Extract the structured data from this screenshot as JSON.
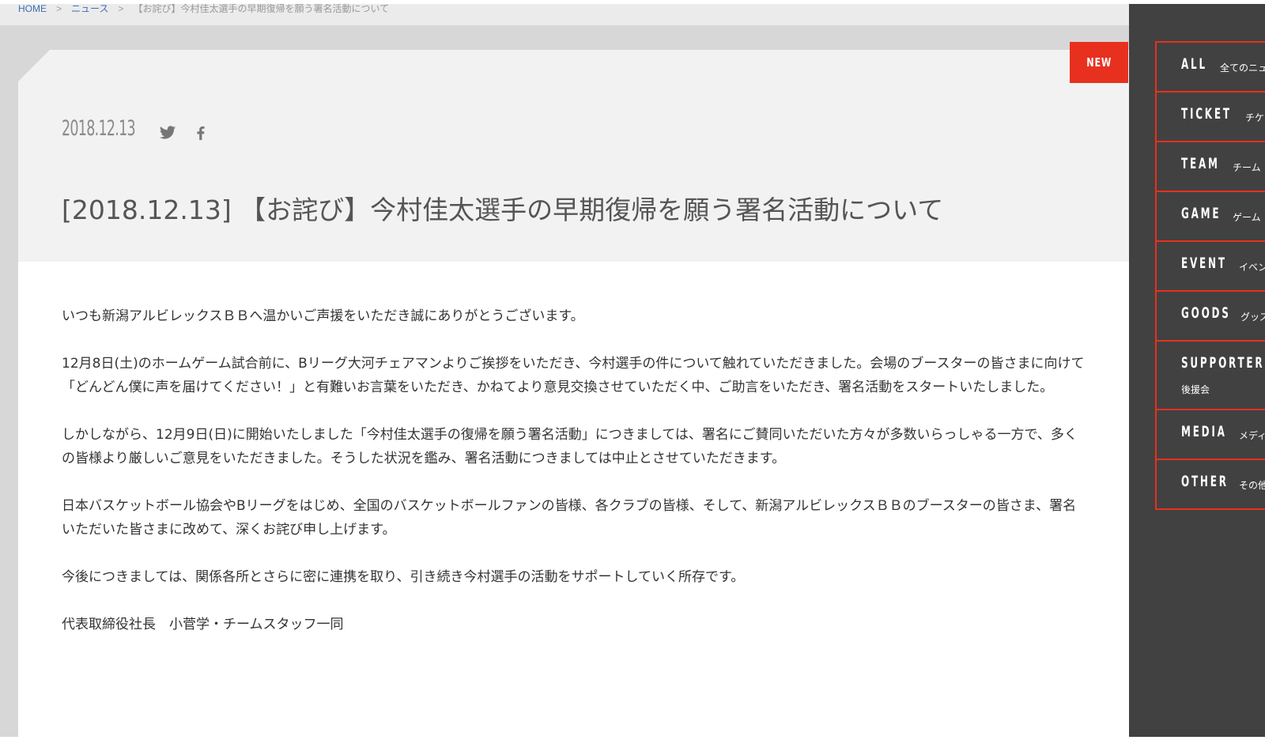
{
  "breadcrumb": {
    "home": "HOME",
    "sep1": ">",
    "news": "ニュース",
    "sep2": ">",
    "current": "【お詫び】今村佳太選手の早期復帰を願う署名活動について"
  },
  "badge": {
    "label": "NEW",
    "color": "#e8301e"
  },
  "post": {
    "date": "2018.12.13",
    "share_icons": [
      "twitter-icon",
      "facebook-icon"
    ],
    "title": "[2018.12.13] 【お詫び】今村佳太選手の早期復帰を願う署名活動について"
  },
  "body": {
    "p1": "いつも新潟アルビレックスＢＢへ温かいご声援をいただき誠にありがとうございます。",
    "p2": "12月8日(土)のホームゲーム試合前に、Bリーグ大河チェアマンよりご挨拶をいただき、今村選手の件について触れていただきました。会場のブースターの皆さまに向けて「どんどん僕に声を届けてください！」と有難いお言葉をいただき、かねてより意見交換させていただく中、ご助言をいただき、署名活動をスタートいたしました。",
    "p3": "しかしながら、12月9日(日)に開始いたしました「今村佳太選手の復帰を願う署名活動」につきましては、署名にご賛同いただいた方々が多数いらっしゃる一方で、多くの皆様より厳しいご意見をいただきました。そうした状況を鑑み、署名活動につきましては中止とさせていただきます。",
    "p4": "日本バスケットボール協会やBリーグをはじめ、全国のバスケットボールファンの皆様、各クラブの皆様、そして、新潟アルビレックスＢＢのブースターの皆さま、署名いただいた皆さまに改めて、深くお詫び申し上げます。",
    "p5": "今後につきましては、関係各所とさらに密に連携を取り、引き続き今村選手の活動をサポートしていく所存です。",
    "p6": "代表取締役社長　小菅学・チームスタッフ一同"
  },
  "sidenav": {
    "accent": "#e8301e",
    "items": [
      {
        "en": "ALL",
        "ja": "全てのニュ"
      },
      {
        "en": "TICKET",
        "ja": "チケ"
      },
      {
        "en": "TEAM",
        "ja": "チーム"
      },
      {
        "en": "GAME",
        "ja": "ゲーム"
      },
      {
        "en": "EVENT",
        "ja": "イベン"
      },
      {
        "en": "GOODS",
        "ja": "グッズ"
      },
      {
        "en": "SUPPORTER",
        "ja": "後援会"
      },
      {
        "en": "MEDIA",
        "ja": "メディ"
      },
      {
        "en": "OTHER",
        "ja": "その他"
      }
    ]
  }
}
